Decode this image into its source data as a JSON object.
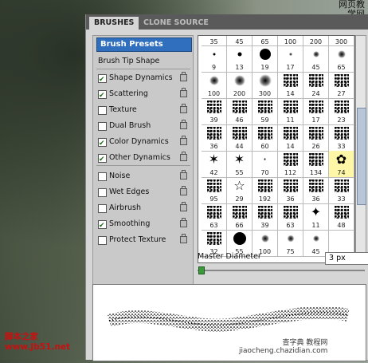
{
  "watermark_top": [
    "网页教",
    "学网"
  ],
  "tabs": [
    {
      "label": "BRUSHES"
    },
    {
      "label": "CLONE SOURCE"
    }
  ],
  "presets_label": "Brush Presets",
  "tip_shape": "Brush Tip Shape",
  "options": [
    {
      "label": "Shape Dynamics",
      "checked": true
    },
    {
      "label": "Scattering",
      "checked": true
    },
    {
      "label": "Texture",
      "checked": false
    },
    {
      "label": "Dual Brush",
      "checked": false
    },
    {
      "label": "Color Dynamics",
      "checked": true
    },
    {
      "label": "Other Dynamics",
      "checked": true
    },
    {
      "label": "Noise",
      "checked": false
    },
    {
      "label": "Wet Edges",
      "checked": false
    },
    {
      "label": "Airbrush",
      "checked": false
    },
    {
      "label": "Smoothing",
      "checked": true
    },
    {
      "label": "Protect Texture",
      "checked": false
    }
  ],
  "brush_rows": [
    [
      "35",
      "45",
      "65",
      "100",
      "200",
      "300"
    ],
    [
      "9",
      "13",
      "19",
      "17",
      "45",
      "65"
    ],
    [
      "100",
      "200",
      "300",
      "14",
      "24",
      "27"
    ],
    [
      "39",
      "46",
      "59",
      "11",
      "17",
      "23"
    ],
    [
      "36",
      "44",
      "60",
      "14",
      "26",
      "33"
    ],
    [
      "42",
      "55",
      "70",
      "112",
      "134",
      "74"
    ],
    [
      "95",
      "29",
      "192",
      "36",
      "36",
      "33"
    ],
    [
      "63",
      "66",
      "39",
      "63",
      "11",
      "48"
    ],
    [
      "32",
      "55",
      "100",
      "75",
      "45",
      ""
    ]
  ],
  "master_diameter_label": "Master Diameter",
  "master_diameter_value": "3 px",
  "watermark_bl": [
    "脚本之家",
    "www.Jb51.net"
  ],
  "watermark_br": [
    "查字典 教程网",
    "jiaocheng.chazidian.com"
  ]
}
